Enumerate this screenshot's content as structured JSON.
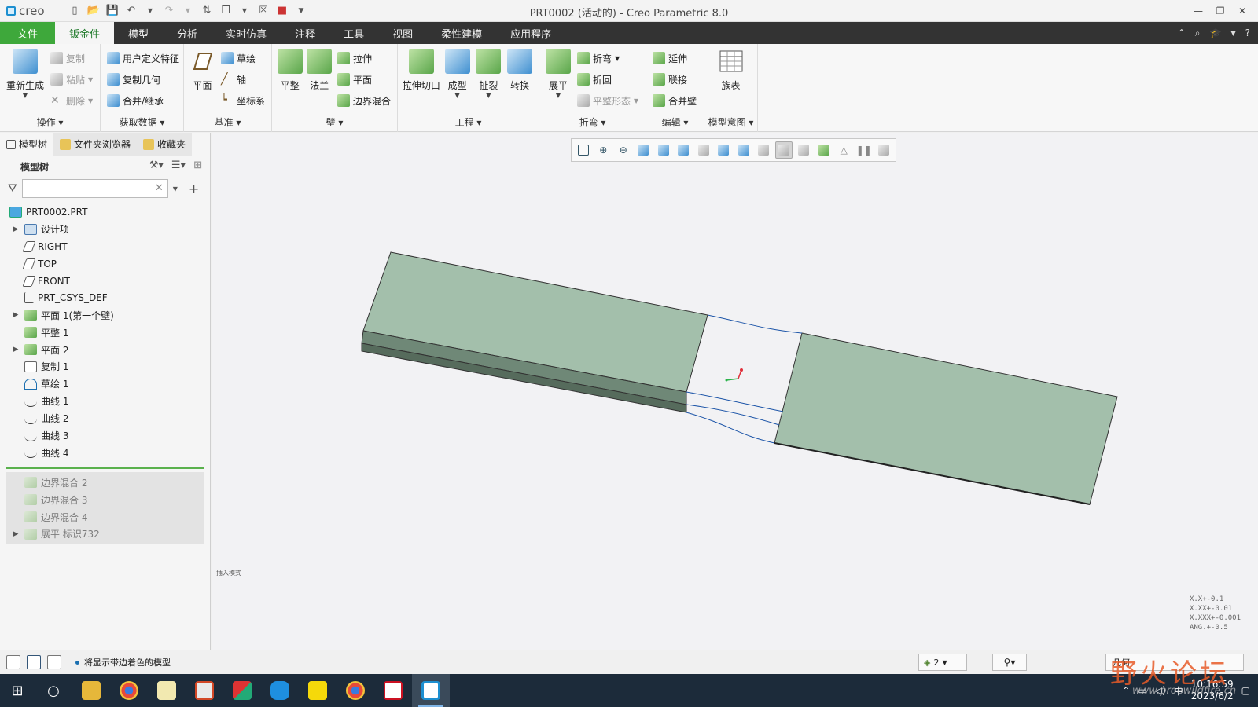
{
  "titlebar": {
    "logo": "creo",
    "title": "PRT0002 (活动的) - Creo Parametric 8.0",
    "quick_access_icons": [
      "new-icon",
      "open-icon",
      "save-icon",
      "undo-icon",
      "redo-icon",
      "regenerate-icon",
      "window-icon",
      "close-window-icon",
      "appearance-icon",
      "customize-icon"
    ]
  },
  "menu": {
    "tabs": [
      "文件",
      "钣金件",
      "模型",
      "分析",
      "实时仿真",
      "注释",
      "工具",
      "视图",
      "柔性建模",
      "应用程序"
    ],
    "active": "钣金件"
  },
  "ribbon": {
    "groups": {
      "operations": {
        "label": "操作",
        "regenerate": "重新生成",
        "copy": "复制",
        "paste": "粘贴",
        "delete": "删除"
      },
      "get_data": {
        "label": "获取数据",
        "udf": "用户定义特征",
        "copy_geom": "复制几何",
        "merge": "合并/继承"
      },
      "datum": {
        "label": "基准",
        "plane": "平面",
        "sketch": "草绘",
        "axis": "轴",
        "csys": "坐标系"
      },
      "wall": {
        "label": "壁",
        "flat": "平整",
        "flange": "法兰",
        "extrude": "拉伸",
        "planar": "平面",
        "boundary": "边界混合"
      },
      "engineering": {
        "label": "工程",
        "extrude_cut": "拉伸切口",
        "form": "成型",
        "rip": "扯裂",
        "convert": "转换"
      },
      "bends": {
        "label": "折弯",
        "unbend": "展平",
        "bend": "折弯",
        "bend_back": "折回",
        "flat_state": "平整形态"
      },
      "editing": {
        "label": "编辑",
        "extend": "延伸",
        "join": "联接",
        "merge_walls": "合并壁"
      },
      "model_intent": {
        "label": "模型意图",
        "family_table": "族表"
      }
    }
  },
  "left_panel": {
    "tabs": [
      "模型树",
      "文件夹浏览器",
      "收藏夹"
    ],
    "tree_title": "模型树",
    "filter_placeholder": "",
    "items": [
      {
        "label": "PRT0002.PRT",
        "icon": "part-icon",
        "arrow": false
      },
      {
        "label": "设计项",
        "icon": "design-items-icon",
        "arrow": true
      },
      {
        "label": "RIGHT",
        "icon": "datum-plane-icon",
        "arrow": false
      },
      {
        "label": "TOP",
        "icon": "datum-plane-icon",
        "arrow": false
      },
      {
        "label": "FRONT",
        "icon": "datum-plane-icon",
        "arrow": false
      },
      {
        "label": "PRT_CSYS_DEF",
        "icon": "csys-icon",
        "arrow": false
      },
      {
        "label": "平面 1(第一个壁)",
        "icon": "planar-wall-icon",
        "arrow": true
      },
      {
        "label": "平整 1",
        "icon": "flat-wall-icon",
        "arrow": false
      },
      {
        "label": "平面 2",
        "icon": "planar-wall-icon",
        "arrow": true
      },
      {
        "label": "复制 1",
        "icon": "copy-icon",
        "arrow": false
      },
      {
        "label": "草绘 1",
        "icon": "sketch-icon",
        "arrow": false
      },
      {
        "label": "曲线 1",
        "icon": "curve-icon",
        "arrow": false
      },
      {
        "label": "曲线 2",
        "icon": "curve-icon",
        "arrow": false
      },
      {
        "label": "曲线 3",
        "icon": "curve-icon",
        "arrow": false
      },
      {
        "label": "曲线 4",
        "icon": "curve-icon",
        "arrow": false
      }
    ],
    "suppressed_items": [
      {
        "label": "边界混合 2",
        "icon": "boundary-blend-icon",
        "arrow": false
      },
      {
        "label": "边界混合 3",
        "icon": "boundary-blend-icon",
        "arrow": false
      },
      {
        "label": "边界混合 4",
        "icon": "boundary-blend-icon",
        "arrow": false
      },
      {
        "label": "展平 标识732",
        "icon": "unbend-icon",
        "arrow": true
      }
    ]
  },
  "graphics": {
    "note": "插入模式",
    "tolerances": [
      "X.X+-0.1",
      "X.XX+-0.01",
      "X.XXX+-0.001",
      "ANG.+-0.5"
    ]
  },
  "statusbar": {
    "message": "将显示带边着色的模型",
    "selection_count": "2",
    "search_value": "几何"
  },
  "taskbar": {
    "time": "10:16:59",
    "date": "2023/6/2",
    "ime": "中"
  },
  "watermark": {
    "text": "野火论坛",
    "url": "www.proewildfire.cn"
  },
  "colors": {
    "accent_green": "#3ea83b",
    "menubar_dark": "#333333",
    "model_face": "#a3bfab",
    "curve_blue": "#1d55a8"
  }
}
